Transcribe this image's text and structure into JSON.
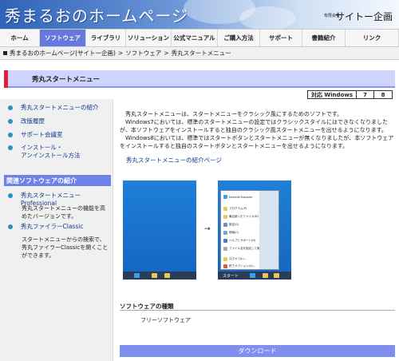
{
  "header": {
    "site_title": "秀まるおのホームページ",
    "company_prefix": "有限会社",
    "company_name": "サイトー企画"
  },
  "nav": {
    "items": [
      {
        "label": "ホーム",
        "active": false
      },
      {
        "label": "ソフトウェア",
        "active": true
      },
      {
        "label": "ライブラリ",
        "active": false
      },
      {
        "label": "ソリューション",
        "active": false
      },
      {
        "label": "公式マニュアル",
        "active": false
      },
      {
        "label": "ご購入方法",
        "active": false
      },
      {
        "label": "サポート",
        "active": false
      },
      {
        "label": "書籍紹介",
        "active": false
      },
      {
        "label": "リンク",
        "active": false
      }
    ]
  },
  "breadcrumb": {
    "items": [
      "秀まるおのホームページ(サイトー企画)",
      "ソフトウェア",
      "秀丸スタートメニュー"
    ]
  },
  "page": {
    "title": "秀丸スタートメニュー",
    "compat": {
      "label": "対応 Windows",
      "values": [
        "7",
        "8"
      ]
    }
  },
  "sidebar": {
    "links": [
      {
        "label": "秀丸スタートメニューの紹介"
      },
      {
        "label": "改版履歴"
      },
      {
        "label": "サポート会議室"
      },
      {
        "label": "インストール・\nアンインストール方法"
      }
    ],
    "related_title": "関連ソフトウェアの紹介",
    "related": [
      {
        "label": "秀丸スタートメニュー Professional",
        "desc": "秀丸スタートメニューの機能を高めたバージョンです。"
      },
      {
        "label": "秀丸ファイラーClassic",
        "desc": "スタートメニューからの検索で、秀丸ファイラーClassicを開くことができます。"
      }
    ]
  },
  "main": {
    "paragraphs": [
      "　秀丸スタートメニューは、スタートメニューをクラシック風にするためのソフトです。\n　Windows7においては、標準のスタートメニューの設定ではクラシックスタイルにはできなくなりましたが、本ソフトウェアをインストールすると独自のクラシック風スタートメニューを出せるようになります。",
      "　Windows8においては、標準ではスタートボタンとスタートメニューが無くなりましたが、本ソフトウェアをインストールすると独自のスタートボタンとスタートメニューを出せるようになります。"
    ],
    "intro_link": "秀丸スタートメニューの紹介ページ",
    "arrow": "→",
    "start_label": "スタート",
    "menu_items": [
      "Internet Explorer",
      "プログラム(P)",
      "最近使ったファイル(D)",
      "設定(S)",
      "検索(C)",
      "ヘルプとサポート(H)",
      "ファイル名を指定して実行(R)...",
      "ログオフ(L)...",
      "終了オプション(U)..."
    ],
    "software_type_label": "ソフトウェアの種類",
    "software_type_value": "フリーソフトウェア",
    "download_label": "ダウンロード"
  },
  "colors": {
    "accent": "#6677dd",
    "title_band": "#ccd4ff",
    "red_marker": "#e0203a",
    "link": "#0c3a8a"
  }
}
